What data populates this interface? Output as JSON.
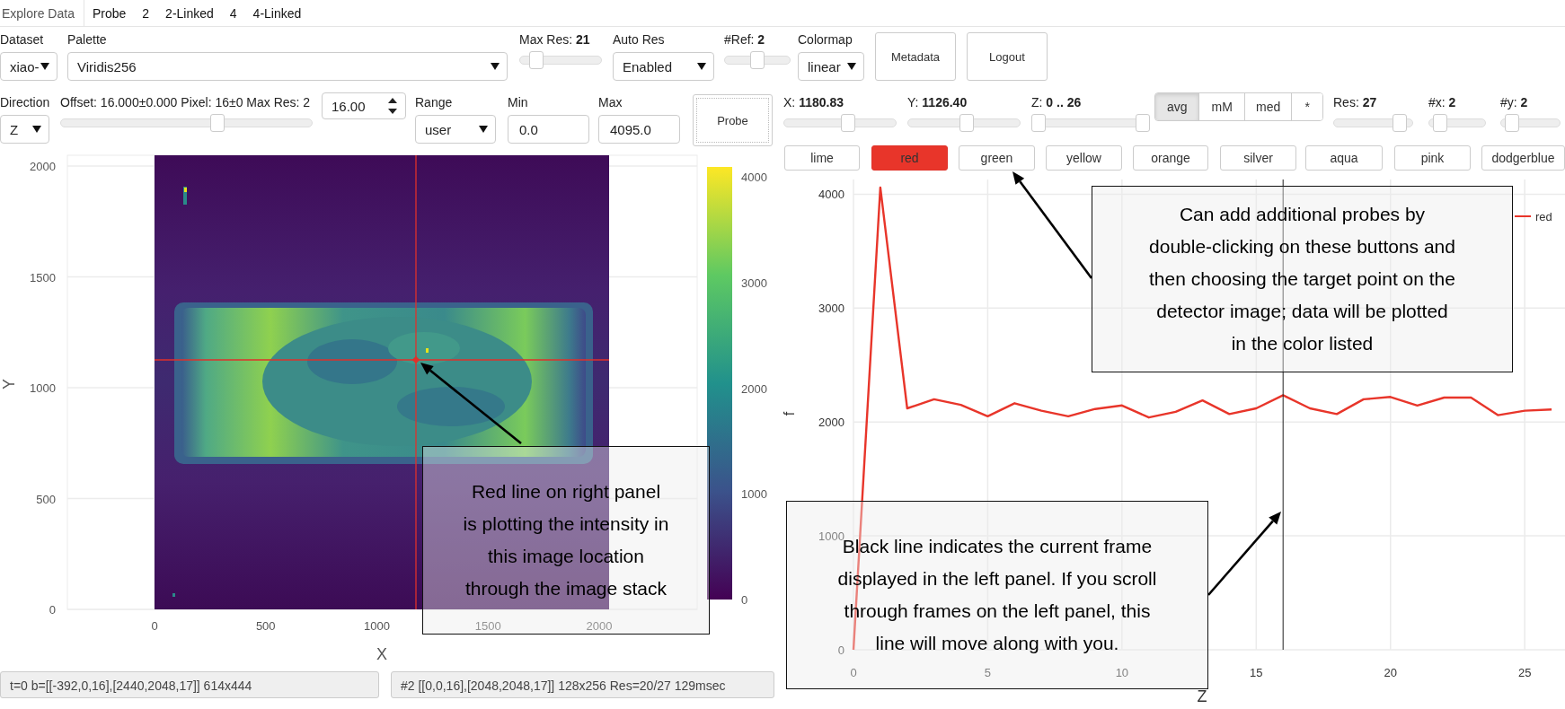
{
  "tabs": [
    {
      "label": "Explore Data",
      "selected": true
    },
    {
      "label": "Probe",
      "selected": false
    },
    {
      "label": "2",
      "selected": false
    },
    {
      "label": "2-Linked",
      "selected": false
    },
    {
      "label": "4",
      "selected": false
    },
    {
      "label": "4-Linked",
      "selected": false
    }
  ],
  "toolbar": [
    {
      "kind": "select",
      "label": "Dataset",
      "value": "xiao-"
    },
    {
      "kind": "select",
      "label": "Palette",
      "value": "Viridis256"
    },
    {
      "kind": "slider",
      "label": "Max Res: **21**",
      "level": 0.15
    },
    {
      "kind": "select",
      "label": "Auto Res",
      "value": "Enabled"
    },
    {
      "kind": "slider",
      "label": "#Ref: **2**",
      "level": 0.5
    },
    {
      "kind": "select",
      "label": "Colormap",
      "value": "linear"
    },
    {
      "kind": "button",
      "label": "Metadata"
    },
    {
      "kind": "button",
      "label": "Logout"
    }
  ],
  "view_controls": [
    {
      "kind": "select",
      "label": "Direction",
      "value": "Z"
    },
    {
      "kind": "slider",
      "label": "Offset: 16.000±0.000 Pixel: 16±0 Max Res: 2",
      "level": 0.63
    },
    {
      "kind": "spin",
      "value": "16.00"
    },
    {
      "kind": "select",
      "label": "Range",
      "value": "user"
    },
    {
      "kind": "input",
      "label": "Min",
      "value": "0.0"
    },
    {
      "kind": "input",
      "label": "Max",
      "value": "4095.0"
    },
    {
      "kind": "button",
      "label": "Probe"
    }
  ],
  "probe_controls": [
    {
      "kind": "slider",
      "label": "X: **1180.83**",
      "level": 0.58
    },
    {
      "kind": "slider",
      "label": "Y: **1126.40**",
      "level": 0.53
    },
    {
      "kind": "range",
      "label": "Z: **0 .. 26**",
      "thumbs": [
        {
          "level": 0
        },
        {
          "level": 1
        }
      ]
    },
    {
      "kind": "group",
      "options": [
        {
          "label": "avg",
          "selected": true
        },
        {
          "label": "mM",
          "selected": false
        },
        {
          "label": "med",
          "selected": false
        },
        {
          "label": "*",
          "selected": false
        }
      ]
    },
    {
      "kind": "slider",
      "label": "Res: **27**",
      "level": 0.9
    },
    {
      "kind": "slider",
      "label": "#x: **2**",
      "level": 0.1
    },
    {
      "kind": "slider",
      "label": "#y: **2**",
      "level": 0.1
    }
  ],
  "probes": [
    {
      "label": "lime",
      "selected": false
    },
    {
      "label": "red",
      "selected": true
    },
    {
      "label": "green",
      "selected": false
    },
    {
      "label": "yellow",
      "selected": false
    },
    {
      "label": "orange",
      "selected": false
    },
    {
      "label": "silver",
      "selected": false
    },
    {
      "label": "aqua",
      "selected": false
    },
    {
      "label": "pink",
      "selected": false
    },
    {
      "label": "dodgerblue",
      "selected": false
    }
  ],
  "image_plot": {
    "xlabel": "X",
    "ylabel": "Y",
    "xticks": [
      "0",
      "500",
      "1000",
      "1500",
      "2000"
    ],
    "yticks": [
      "2000",
      "1500",
      "1000",
      "500",
      "0"
    ],
    "colorbar_ticks": [
      "4000",
      "3000",
      "2000",
      "1000",
      "0"
    ]
  },
  "status": [
    "t=0 b=[[-392,0,16],[2440,2048,17]] 614x444",
    "#2 [[0,0,16],[2048,2048,17]] 128x256 Res=20/27 129msec"
  ],
  "chart": {
    "chart_data": {
      "type": "line",
      "xlabel": "Z",
      "ylabel": "f",
      "x": [
        0,
        1,
        2,
        3,
        4,
        5,
        6,
        7,
        8,
        9,
        10,
        11,
        12,
        13,
        14,
        15,
        16,
        17,
        18,
        19,
        20,
        21,
        22,
        23,
        24,
        25,
        26
      ],
      "xlim": [
        0,
        26.5
      ],
      "ylim": [
        0,
        4130
      ],
      "xticks": [
        0,
        5,
        10,
        15,
        20,
        25
      ],
      "yticks": [
        0,
        1000,
        2000,
        3000,
        4000
      ],
      "grid": true,
      "ref_lines": [
        {
          "axis": "x",
          "value": 16,
          "color": "#222222"
        }
      ],
      "series": [
        {
          "name": "red",
          "color": "#e8352a",
          "values": [
            0,
            4060,
            2120,
            2200,
            2150,
            2050,
            2165,
            2100,
            2050,
            2115,
            2145,
            2040,
            2090,
            2190,
            2070,
            2120,
            2235,
            2120,
            2070,
            2200,
            2220,
            2145,
            2215,
            2215,
            2060,
            2100,
            2110
          ]
        }
      ]
    }
  },
  "callouts": [
    {
      "text": "Red line on right panel is plotting the intensity in this image location through the image stack"
    },
    {
      "text": "Can add additional probes by double-clicking on these buttons and then choosing the target point on the detector image; data will be plotted in the color listed"
    },
    {
      "text": "Black line indicates the current frame displayed in the left panel. If you scroll through frames on the left panel, this line will move along with you."
    }
  ]
}
